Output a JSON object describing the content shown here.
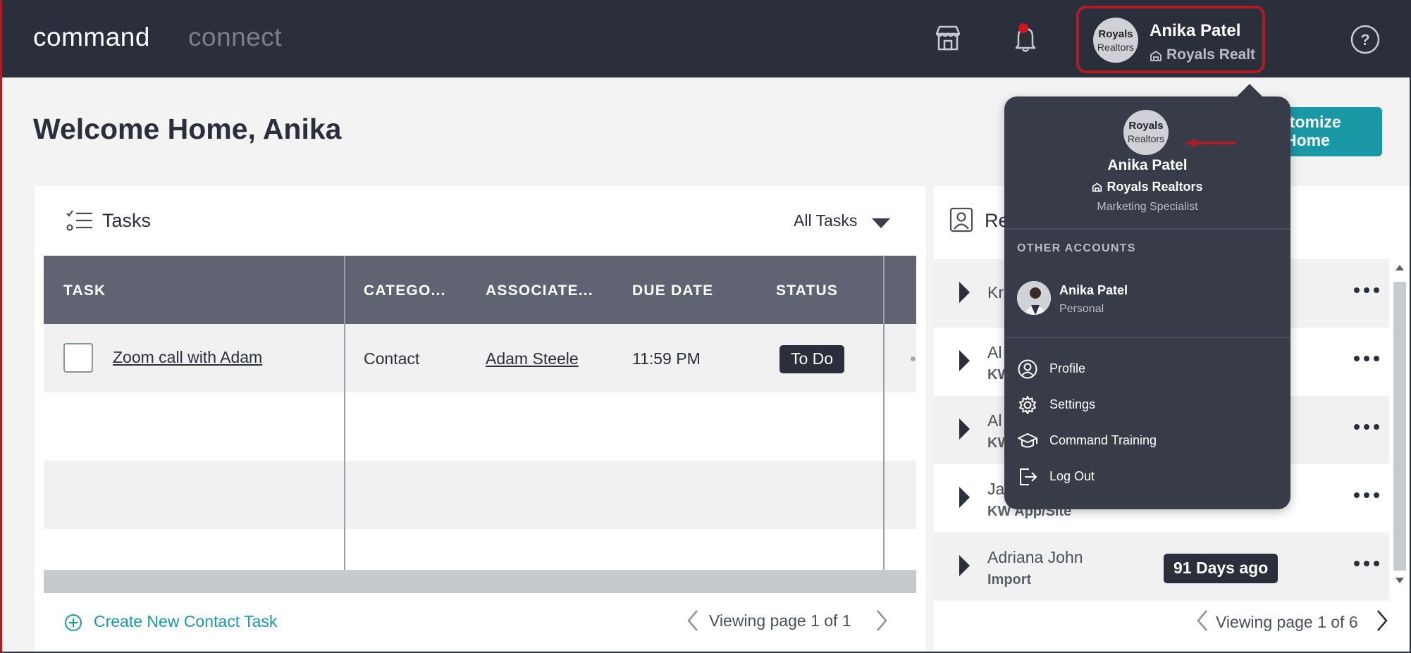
{
  "brand": {
    "primary": "command",
    "secondary": "connect"
  },
  "header": {
    "account_name": "Anika Patel",
    "account_org": "Royals Realt",
    "avatar_logo_line1": "Royals",
    "avatar_logo_line2": "Realtors",
    "icons": [
      "store-icon",
      "bell-icon",
      "help-icon"
    ]
  },
  "page": {
    "welcome": "Welcome Home, Anika",
    "customize_line1": "stomize",
    "customize_line2": "Home"
  },
  "tasks": {
    "title": "Tasks",
    "filter": "All Tasks",
    "columns": [
      "TASK",
      "CATEGO...",
      "ASSOCIATE...",
      "DUE DATE",
      "STATUS"
    ],
    "rows": [
      {
        "task": "Zoom call with Adam",
        "category": "Contact",
        "associate": "Adam Steele",
        "due": "11:59 PM",
        "status": "To Do"
      }
    ],
    "create_label": "Create New Contact Task",
    "pager": "Viewing page 1 of 1"
  },
  "leads": {
    "title": "Re",
    "rows": [
      {
        "name": "Kr",
        "source": ""
      },
      {
        "name": "Al",
        "source": "KW"
      },
      {
        "name": "Al",
        "source": "KW"
      },
      {
        "name": "Ja",
        "source": "KW App/Site"
      },
      {
        "name": "Adriana John",
        "source": "Import",
        "badge": "91 Days ago"
      }
    ],
    "pager": "Viewing page 1 of 6"
  },
  "dropdown": {
    "name": "Anika Patel",
    "org": "Royals Realtors",
    "role": "Marketing Specialist",
    "section_label": "OTHER ACCOUNTS",
    "other_account": {
      "name": "Anika Patel",
      "type": "Personal"
    },
    "menu": [
      {
        "label": "Profile",
        "icon": "user-circle-icon"
      },
      {
        "label": "Settings",
        "icon": "gear-icon"
      },
      {
        "label": "Command Training",
        "icon": "graduation-cap-icon"
      },
      {
        "label": "Log Out",
        "icon": "logout-icon"
      }
    ]
  },
  "colors": {
    "topbar": "#2b2f3b",
    "accent": "#1b98a6",
    "highlight": "#b11c24",
    "notification": "#d0151f",
    "dropdown_bg": "#383c48"
  }
}
